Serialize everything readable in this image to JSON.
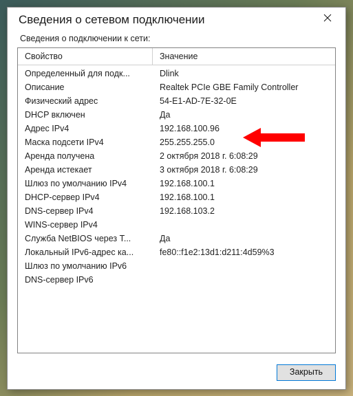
{
  "window": {
    "title": "Сведения о сетевом подключении",
    "subtitle": "Сведения о подключении к сети:"
  },
  "columns": {
    "property": "Свойство",
    "value": "Значение"
  },
  "rows": [
    {
      "property": "Определенный для подк...",
      "value": "Dlink"
    },
    {
      "property": "Описание",
      "value": "Realtek PCIe GBE Family Controller"
    },
    {
      "property": "Физический адрес",
      "value": "54-E1-AD-7E-32-0E"
    },
    {
      "property": "DHCP включен",
      "value": "Да"
    },
    {
      "property": "Адрес IPv4",
      "value": "192.168.100.96"
    },
    {
      "property": "Маска подсети IPv4",
      "value": "255.255.255.0"
    },
    {
      "property": "Аренда получена",
      "value": "2 октября 2018 г. 6:08:29"
    },
    {
      "property": "Аренда истекает",
      "value": "3 октября 2018 г. 6:08:29"
    },
    {
      "property": "Шлюз по умолчанию IPv4",
      "value": "192.168.100.1"
    },
    {
      "property": "DHCP-сервер IPv4",
      "value": "192.168.100.1"
    },
    {
      "property": "DNS-сервер IPv4",
      "value": "192.168.103.2"
    },
    {
      "property": "WINS-сервер IPv4",
      "value": ""
    },
    {
      "property": "Служба NetBIOS через T...",
      "value": "Да"
    },
    {
      "property": "Локальный IPv6-адрес ка...",
      "value": "fe80::f1e2:13d1:d211:4d59%3"
    },
    {
      "property": "Шлюз по умолчанию IPv6",
      "value": ""
    },
    {
      "property": "DNS-сервер IPv6",
      "value": ""
    }
  ],
  "footer": {
    "close_label": "Закрыть"
  },
  "annotation": {
    "arrow_color": "#ff0000",
    "highlight_row_index": 4
  }
}
